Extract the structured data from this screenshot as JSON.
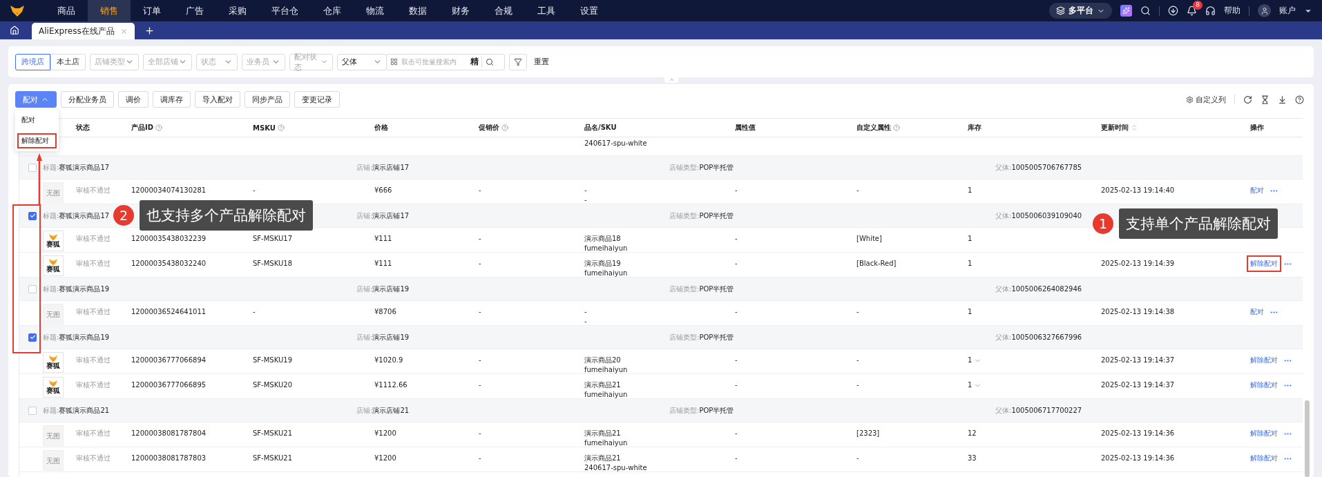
{
  "nav": {
    "items": [
      {
        "label": "商品",
        "selected": false
      },
      {
        "label": "销售",
        "selected": true
      },
      {
        "label": "订单",
        "selected": false
      },
      {
        "label": "广告",
        "selected": false
      },
      {
        "label": "采购",
        "selected": false
      },
      {
        "label": "平台仓",
        "selected": false
      },
      {
        "label": "仓库",
        "selected": false
      },
      {
        "label": "物流",
        "selected": false
      },
      {
        "label": "数据",
        "selected": false
      },
      {
        "label": "财务",
        "selected": false
      },
      {
        "label": "合规",
        "selected": false
      },
      {
        "label": "工具",
        "selected": false
      },
      {
        "label": "设置",
        "selected": false
      }
    ],
    "platform": "多平台",
    "notification_count": "8",
    "help": "帮助",
    "account": "账户"
  },
  "tabs": [
    {
      "label": "AliExpress在线产品",
      "selected": true
    }
  ],
  "filters": {
    "segments": [
      {
        "label": "跨境店",
        "selected": true
      },
      {
        "label": "本土店",
        "selected": false
      }
    ],
    "selects": [
      {
        "placeholder": "店铺类型"
      },
      {
        "placeholder": "全部店铺"
      },
      {
        "placeholder": "状态"
      },
      {
        "placeholder": "业务员"
      },
      {
        "placeholder": "配对状态"
      },
      {
        "value": "父体"
      }
    ],
    "search": {
      "placeholder": "双击可批量搜索内",
      "exact": "精"
    },
    "reset": "重置"
  },
  "toolbar": {
    "buttons": [
      {
        "label": "配对",
        "kind": "primary",
        "expanded": true
      },
      {
        "label": "分配业务员",
        "kind": "default"
      },
      {
        "label": "调价",
        "kind": "default"
      },
      {
        "label": "调库存",
        "kind": "default"
      },
      {
        "label": "导入配对",
        "kind": "default"
      },
      {
        "label": "同步产品",
        "kind": "default"
      },
      {
        "label": "变更记录",
        "kind": "default"
      }
    ],
    "custom_columns": "自定义列"
  },
  "menu": {
    "items": [
      {
        "label": "配对",
        "annotated": false
      },
      {
        "label": "解除配对",
        "annotated": true
      }
    ]
  },
  "table": {
    "columns": [
      {
        "label": "状态",
        "help": false,
        "sortable": false
      },
      {
        "label": "产品ID",
        "help": true,
        "sortable": false
      },
      {
        "label": "MSKU",
        "help": true,
        "sortable": false
      },
      {
        "label": "价格",
        "help": false,
        "sortable": false
      },
      {
        "label": "促销价",
        "help": true,
        "sortable": false
      },
      {
        "label": "品名/SKU",
        "help": false,
        "sortable": false
      },
      {
        "label": "属性值",
        "help": false,
        "sortable": false
      },
      {
        "label": "自定义属性",
        "help": true,
        "sortable": false
      },
      {
        "label": "库存",
        "help": false,
        "sortable": false
      },
      {
        "label": "更新时间",
        "help": false,
        "sortable": true
      },
      {
        "label": "操作",
        "help": false,
        "sortable": false
      }
    ],
    "rows": [
      {
        "kind": "partial",
        "name_lines": [
          "240617-spu-white"
        ]
      },
      {
        "kind": "group",
        "checked": false,
        "fields": [
          {
            "label": "标题:",
            "value": "赛狐演示商品17"
          },
          {
            "label": "店铺:",
            "value": "演示店铺17"
          },
          {
            "label": "店铺类型:",
            "value": "POP半托管"
          },
          {
            "label": "父体:",
            "value": "1005005706767785"
          }
        ]
      },
      {
        "kind": "product",
        "image": {
          "kind": "none",
          "label": "无图"
        },
        "status": "审核不通过",
        "id": "12000034074130281",
        "msku": "-",
        "price": "¥666",
        "promo": "-",
        "name_lines": [
          "-",
          "-"
        ],
        "attr": "-",
        "custom_attr": "-",
        "stock": {
          "value": "1",
          "expandable": false
        },
        "time": "2025-02-13 19:14:40",
        "action": {
          "label": "配对",
          "annotated": false
        }
      },
      {
        "kind": "group",
        "checked": true,
        "fields": [
          {
            "label": "标题:",
            "value": "赛狐演示商品17"
          },
          {
            "label": "店铺:",
            "value": "演示店铺17"
          },
          {
            "label": "店铺类型:",
            "value": "POP半托管"
          },
          {
            "label": "父体:",
            "value": "1005006039109040"
          }
        ]
      },
      {
        "kind": "product",
        "image": {
          "kind": "logo",
          "label": "赛狐"
        },
        "status": "审核不通过",
        "id": "12000035438032239",
        "msku": "SF-MSKU17",
        "price": "¥111",
        "promo": "-",
        "name_lines": [
          "演示商品18",
          "fumeihaiyun"
        ],
        "attr": "-",
        "custom_attr": "[White]",
        "stock": {
          "value": "1",
          "expandable": false
        }
      },
      {
        "kind": "product",
        "image": {
          "kind": "logo",
          "label": "赛狐"
        },
        "status": "审核不通过",
        "id": "12000035438032240",
        "msku": "SF-MSKU18",
        "price": "¥111",
        "promo": "-",
        "name_lines": [
          "演示商品19",
          "fumeihaiyun"
        ],
        "attr": "-",
        "custom_attr": "[Black-Red]",
        "stock": {
          "value": "1",
          "expandable": false
        },
        "time": "2025-02-13 19:14:39",
        "action": {
          "label": "解除配对",
          "annotated": true
        }
      },
      {
        "kind": "group",
        "checked": false,
        "fields": [
          {
            "label": "标题:",
            "value": "赛狐演示商品19"
          },
          {
            "label": "店铺:",
            "value": "演示店铺19"
          },
          {
            "label": "店铺类型:",
            "value": "POP半托管"
          },
          {
            "label": "父体:",
            "value": "1005006264082946"
          }
        ]
      },
      {
        "kind": "product",
        "image": {
          "kind": "none",
          "label": "无图"
        },
        "status": "审核不通过",
        "id": "12000036524641011",
        "msku": "-",
        "price": "¥8706",
        "promo": "-",
        "name_lines": [
          "-",
          "-"
        ],
        "attr": "-",
        "custom_attr": "-",
        "stock": {
          "value": "1",
          "expandable": false
        },
        "time": "2025-02-13 19:14:38",
        "action": {
          "label": "配对",
          "annotated": false
        }
      },
      {
        "kind": "group",
        "checked": true,
        "fields": [
          {
            "label": "标题:",
            "value": "赛狐演示商品19"
          },
          {
            "label": "店铺:",
            "value": "演示店铺19"
          },
          {
            "label": "店铺类型:",
            "value": "POP半托管"
          },
          {
            "label": "父体:",
            "value": "1005006327667996"
          }
        ]
      },
      {
        "kind": "product",
        "image": {
          "kind": "logo",
          "label": "赛狐"
        },
        "status": "审核不通过",
        "id": "12000036777066894",
        "msku": "SF-MSKU19",
        "price": "¥1020.9",
        "promo": "-",
        "name_lines": [
          "演示商品20",
          "fumeihaiyun"
        ],
        "attr": "-",
        "custom_attr": "-",
        "stock": {
          "value": "1",
          "expandable": true
        },
        "time": "2025-02-13 19:14:37",
        "action": {
          "label": "解除配对",
          "annotated": false
        }
      },
      {
        "kind": "product",
        "image": {
          "kind": "logo",
          "label": "赛狐"
        },
        "status": "审核不通过",
        "id": "12000036777066895",
        "msku": "SF-MSKU20",
        "price": "¥1112.66",
        "promo": "-",
        "name_lines": [
          "演示商品21",
          "fumeihaiyun"
        ],
        "attr": "-",
        "custom_attr": "-",
        "stock": {
          "value": "1",
          "expandable": true
        },
        "time": "2025-02-13 19:14:37",
        "action": {
          "label": "解除配对",
          "annotated": false
        }
      },
      {
        "kind": "group",
        "checked": false,
        "fields": [
          {
            "label": "标题:",
            "value": "赛狐演示商品21"
          },
          {
            "label": "店铺:",
            "value": "演示店铺21"
          },
          {
            "label": "店铺类型:",
            "value": "POP半托管"
          },
          {
            "label": "父体:",
            "value": "1005006717700227"
          }
        ]
      },
      {
        "kind": "product",
        "image": {
          "kind": "none",
          "label": "无图"
        },
        "status": "审核不通过",
        "id": "12000038081787804",
        "msku": "SF-MSKU21",
        "price": "¥1200",
        "promo": "-",
        "name_lines": [
          "演示商品21",
          "fumeihaiyun"
        ],
        "attr": "-",
        "custom_attr": "[2323]",
        "stock": {
          "value": "12",
          "expandable": false
        },
        "time": "2025-02-13 19:14:36",
        "action": {
          "label": "解除配对",
          "annotated": false
        }
      },
      {
        "kind": "product",
        "image": {
          "kind": "none",
          "label": "无图"
        },
        "status": "审核不通过",
        "id": "12000038081787803",
        "msku": "SF-MSKU21",
        "price": "¥1200",
        "promo": "-",
        "name_lines": [
          "演示商品21",
          "240617-spu-white"
        ],
        "attr": "-",
        "custom_attr": "-",
        "stock": {
          "value": "33",
          "expandable": false
        },
        "time": "2025-02-13 19:14:36",
        "action": {
          "label": "解除配对",
          "annotated": false
        }
      }
    ]
  },
  "callouts": [
    {
      "number": "2",
      "text": "也支持多个产品解除配对"
    },
    {
      "number": "1",
      "text": "支持单个产品解除配对"
    }
  ]
}
